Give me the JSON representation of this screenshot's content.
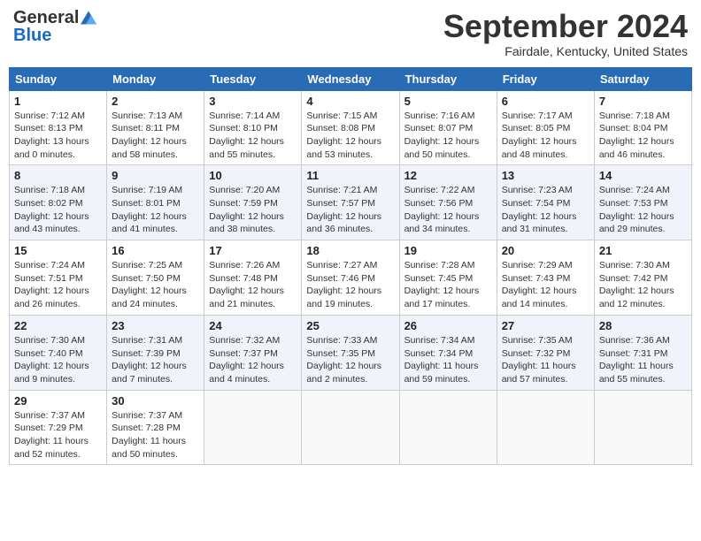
{
  "header": {
    "logo_general": "General",
    "logo_blue": "Blue",
    "title": "September 2024",
    "subtitle": "Fairdale, Kentucky, United States"
  },
  "days_of_week": [
    "Sunday",
    "Monday",
    "Tuesday",
    "Wednesday",
    "Thursday",
    "Friday",
    "Saturday"
  ],
  "weeks": [
    [
      {
        "day": "1",
        "info": "Sunrise: 7:12 AM\nSunset: 8:13 PM\nDaylight: 13 hours\nand 0 minutes."
      },
      {
        "day": "2",
        "info": "Sunrise: 7:13 AM\nSunset: 8:11 PM\nDaylight: 12 hours\nand 58 minutes."
      },
      {
        "day": "3",
        "info": "Sunrise: 7:14 AM\nSunset: 8:10 PM\nDaylight: 12 hours\nand 55 minutes."
      },
      {
        "day": "4",
        "info": "Sunrise: 7:15 AM\nSunset: 8:08 PM\nDaylight: 12 hours\nand 53 minutes."
      },
      {
        "day": "5",
        "info": "Sunrise: 7:16 AM\nSunset: 8:07 PM\nDaylight: 12 hours\nand 50 minutes."
      },
      {
        "day": "6",
        "info": "Sunrise: 7:17 AM\nSunset: 8:05 PM\nDaylight: 12 hours\nand 48 minutes."
      },
      {
        "day": "7",
        "info": "Sunrise: 7:18 AM\nSunset: 8:04 PM\nDaylight: 12 hours\nand 46 minutes."
      }
    ],
    [
      {
        "day": "8",
        "info": "Sunrise: 7:18 AM\nSunset: 8:02 PM\nDaylight: 12 hours\nand 43 minutes."
      },
      {
        "day": "9",
        "info": "Sunrise: 7:19 AM\nSunset: 8:01 PM\nDaylight: 12 hours\nand 41 minutes."
      },
      {
        "day": "10",
        "info": "Sunrise: 7:20 AM\nSunset: 7:59 PM\nDaylight: 12 hours\nand 38 minutes."
      },
      {
        "day": "11",
        "info": "Sunrise: 7:21 AM\nSunset: 7:57 PM\nDaylight: 12 hours\nand 36 minutes."
      },
      {
        "day": "12",
        "info": "Sunrise: 7:22 AM\nSunset: 7:56 PM\nDaylight: 12 hours\nand 34 minutes."
      },
      {
        "day": "13",
        "info": "Sunrise: 7:23 AM\nSunset: 7:54 PM\nDaylight: 12 hours\nand 31 minutes."
      },
      {
        "day": "14",
        "info": "Sunrise: 7:24 AM\nSunset: 7:53 PM\nDaylight: 12 hours\nand 29 minutes."
      }
    ],
    [
      {
        "day": "15",
        "info": "Sunrise: 7:24 AM\nSunset: 7:51 PM\nDaylight: 12 hours\nand 26 minutes."
      },
      {
        "day": "16",
        "info": "Sunrise: 7:25 AM\nSunset: 7:50 PM\nDaylight: 12 hours\nand 24 minutes."
      },
      {
        "day": "17",
        "info": "Sunrise: 7:26 AM\nSunset: 7:48 PM\nDaylight: 12 hours\nand 21 minutes."
      },
      {
        "day": "18",
        "info": "Sunrise: 7:27 AM\nSunset: 7:46 PM\nDaylight: 12 hours\nand 19 minutes."
      },
      {
        "day": "19",
        "info": "Sunrise: 7:28 AM\nSunset: 7:45 PM\nDaylight: 12 hours\nand 17 minutes."
      },
      {
        "day": "20",
        "info": "Sunrise: 7:29 AM\nSunset: 7:43 PM\nDaylight: 12 hours\nand 14 minutes."
      },
      {
        "day": "21",
        "info": "Sunrise: 7:30 AM\nSunset: 7:42 PM\nDaylight: 12 hours\nand 12 minutes."
      }
    ],
    [
      {
        "day": "22",
        "info": "Sunrise: 7:30 AM\nSunset: 7:40 PM\nDaylight: 12 hours\nand 9 minutes."
      },
      {
        "day": "23",
        "info": "Sunrise: 7:31 AM\nSunset: 7:39 PM\nDaylight: 12 hours\nand 7 minutes."
      },
      {
        "day": "24",
        "info": "Sunrise: 7:32 AM\nSunset: 7:37 PM\nDaylight: 12 hours\nand 4 minutes."
      },
      {
        "day": "25",
        "info": "Sunrise: 7:33 AM\nSunset: 7:35 PM\nDaylight: 12 hours\nand 2 minutes."
      },
      {
        "day": "26",
        "info": "Sunrise: 7:34 AM\nSunset: 7:34 PM\nDaylight: 11 hours\nand 59 minutes."
      },
      {
        "day": "27",
        "info": "Sunrise: 7:35 AM\nSunset: 7:32 PM\nDaylight: 11 hours\nand 57 minutes."
      },
      {
        "day": "28",
        "info": "Sunrise: 7:36 AM\nSunset: 7:31 PM\nDaylight: 11 hours\nand 55 minutes."
      }
    ],
    [
      {
        "day": "29",
        "info": "Sunrise: 7:37 AM\nSunset: 7:29 PM\nDaylight: 11 hours\nand 52 minutes."
      },
      {
        "day": "30",
        "info": "Sunrise: 7:37 AM\nSunset: 7:28 PM\nDaylight: 11 hours\nand 50 minutes."
      },
      {
        "day": "",
        "info": ""
      },
      {
        "day": "",
        "info": ""
      },
      {
        "day": "",
        "info": ""
      },
      {
        "day": "",
        "info": ""
      },
      {
        "day": "",
        "info": ""
      }
    ]
  ]
}
